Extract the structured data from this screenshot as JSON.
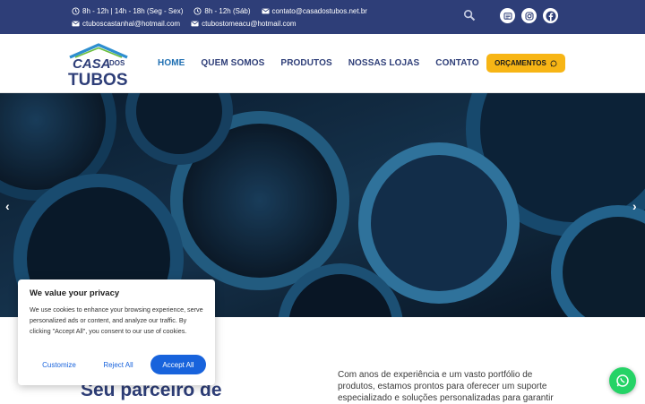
{
  "topbar": {
    "hours_week": "8h - 12h | 14h - 18h (Seg - Sex)",
    "hours_sat": "8h - 12h (Sáb)",
    "email_main": "contato@casadostubos.net.br",
    "email_castanhal": "ctuboscastanhal@hotmail.com",
    "email_tomeacu": "ctubostomeacu@hotmail.com"
  },
  "logo": {
    "line1a": "CASA",
    "line1b": "DOS",
    "line2": "TUBOS"
  },
  "nav": {
    "items": [
      "HOME",
      "QUEM SOMOS",
      "PRODUTOS",
      "NOSSAS LOJAS",
      "CONTATO"
    ],
    "cta_label": "ORÇAMENTOS"
  },
  "hero": {
    "prev": "‹",
    "next": "›"
  },
  "section": {
    "title": "Seu parceiro de",
    "text": "Com anos de experiência e um vasto portfólio de produtos, estamos prontos para oferecer um suporte especializado e soluções personalizadas para garantir"
  },
  "cookie": {
    "title": "We value your privacy",
    "text": "We use cookies to enhance your browsing experience, serve personalized ads or content, and analyze our traffic. By clicking \"Accept All\", you consent to our use of cookies.",
    "customize": "Customize",
    "reject": "Reject All",
    "accept": "Accept All"
  },
  "colors": {
    "brand_navy": "#2e3e78",
    "accent_yellow": "#f7b515",
    "cookie_blue": "#1863dc",
    "whatsapp_green": "#25d366"
  },
  "icons": [
    "clock-icon",
    "mail-icon",
    "search-icon",
    "social-web-icon",
    "instagram-icon",
    "facebook-icon",
    "whatsapp-icon",
    "chevron-left-icon",
    "chevron-right-icon"
  ]
}
